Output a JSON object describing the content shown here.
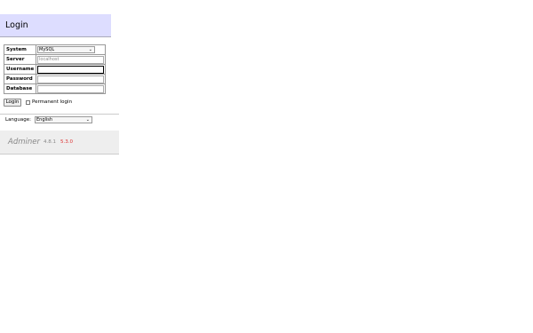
{
  "header": {
    "title": "Login"
  },
  "form": {
    "system": {
      "label": "System",
      "value": "MySQL"
    },
    "server": {
      "label": "Server",
      "placeholder": "localhost",
      "value": ""
    },
    "username": {
      "label": "Username",
      "value": ""
    },
    "password": {
      "label": "Password",
      "value": ""
    },
    "database": {
      "label": "Database",
      "value": ""
    },
    "login_label": "Login",
    "permanent_login_label": "Permanent login",
    "permanent_login_checked": false
  },
  "language": {
    "label": "Language:",
    "value": "English"
  },
  "footer": {
    "brand": "Adminer",
    "version": "4.8.1",
    "new_version": "5.3.0"
  }
}
